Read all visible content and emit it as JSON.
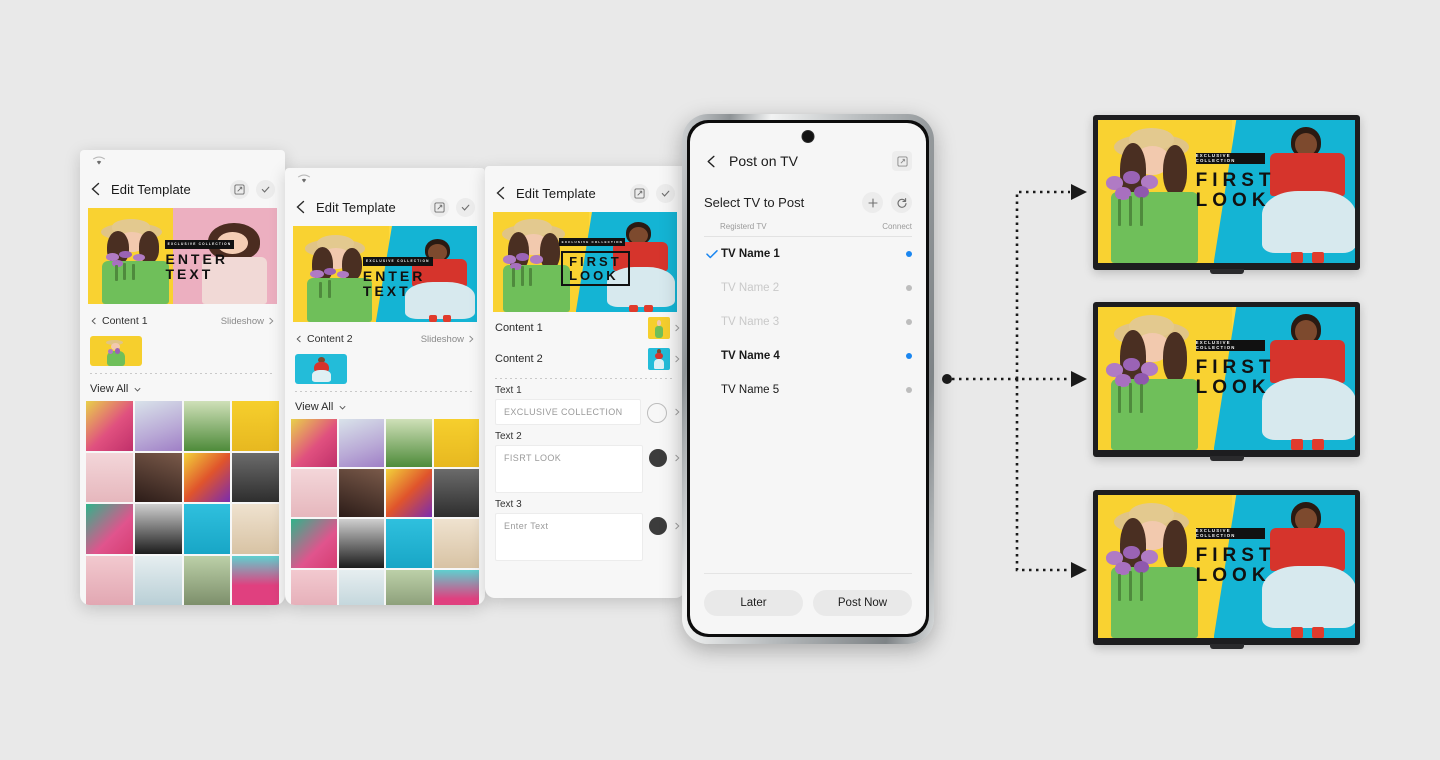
{
  "background_color": "#e9e9e9",
  "accent_color": "#1a86f0",
  "panels": [
    {
      "id": "panel-1",
      "title": "Edit Template",
      "status_icon": "wifi-icon",
      "header_icons": [
        "expand-icon",
        "check-icon"
      ],
      "content_label": "Content 1",
      "slideshow_label": "Slideshow",
      "view_all_label": "View All",
      "hero_text": "ENTER TEXT",
      "hero_badge": "EXCLUSIVE COLLECTION"
    },
    {
      "id": "panel-2",
      "title": "Edit Template",
      "header_icons": [
        "expand-icon",
        "check-icon"
      ],
      "content_label": "Content 2",
      "slideshow_label": "Slideshow",
      "view_all_label": "View All",
      "hero_text": "ENTER TEXT",
      "hero_badge": "EXCLUSIVE COLLECTION"
    },
    {
      "id": "panel-3",
      "title": "Edit Template",
      "header_icons": [
        "expand-icon",
        "check-icon"
      ],
      "content_rows": [
        {
          "label": "Content 1"
        },
        {
          "label": "Content 2"
        }
      ],
      "text_fields": [
        {
          "label": "Text 1",
          "value": "EXCLUSIVE COLLECTION",
          "knob": "empty"
        },
        {
          "label": "Text 2",
          "value": "FISRT LOOK",
          "knob": "dark"
        },
        {
          "label": "Text 3",
          "value": "Enter Text",
          "knob": "dark"
        }
      ],
      "hero_text_line1": "FIRST",
      "hero_text_line2": "LOOK",
      "hero_badge": "EXCLUSIVE COLLECTION"
    }
  ],
  "phone": {
    "header": {
      "title": "Post on TV",
      "back_icon": "back-chevron-icon",
      "expand_icon": "expand-icon"
    },
    "section_title": "Select TV to Post",
    "add_icon": "plus-icon",
    "refresh_icon": "refresh-icon",
    "columns": {
      "name": "Registerd TV",
      "connect": "Connect"
    },
    "tv_list": [
      {
        "name": "TV Name 1",
        "selected": true,
        "enabled": true,
        "connected": true
      },
      {
        "name": "TV Name 2",
        "selected": false,
        "enabled": false,
        "connected": false
      },
      {
        "name": "TV Name 3",
        "selected": false,
        "enabled": false,
        "connected": false
      },
      {
        "name": "TV Name 4",
        "selected": false,
        "enabled": true,
        "connected": true
      },
      {
        "name": "TV Name 5",
        "selected": false,
        "enabled": true,
        "connected": false
      }
    ],
    "actions": {
      "later": "Later",
      "post_now": "Post Now"
    }
  },
  "tvs": [
    {
      "id": "tv-1",
      "badge": "EXCLUSIVE COLLECTION",
      "line1": "FIRST",
      "line2": "LOOK"
    },
    {
      "id": "tv-2",
      "badge": "EXCLUSIVE COLLECTION",
      "line1": "FIRST",
      "line2": "LOOK"
    },
    {
      "id": "tv-3",
      "badge": "EXCLUSIVE COLLECTION",
      "line1": "FIRST",
      "line2": "LOOK"
    }
  ],
  "colors": {
    "art_yellow": "#f9d231",
    "art_cyan": "#14b4d4",
    "art_pink": "#ecafc0",
    "badge_black": "#111111",
    "connected_blue": "#1a86f0",
    "disabled_gray": "#c9c9c9"
  }
}
